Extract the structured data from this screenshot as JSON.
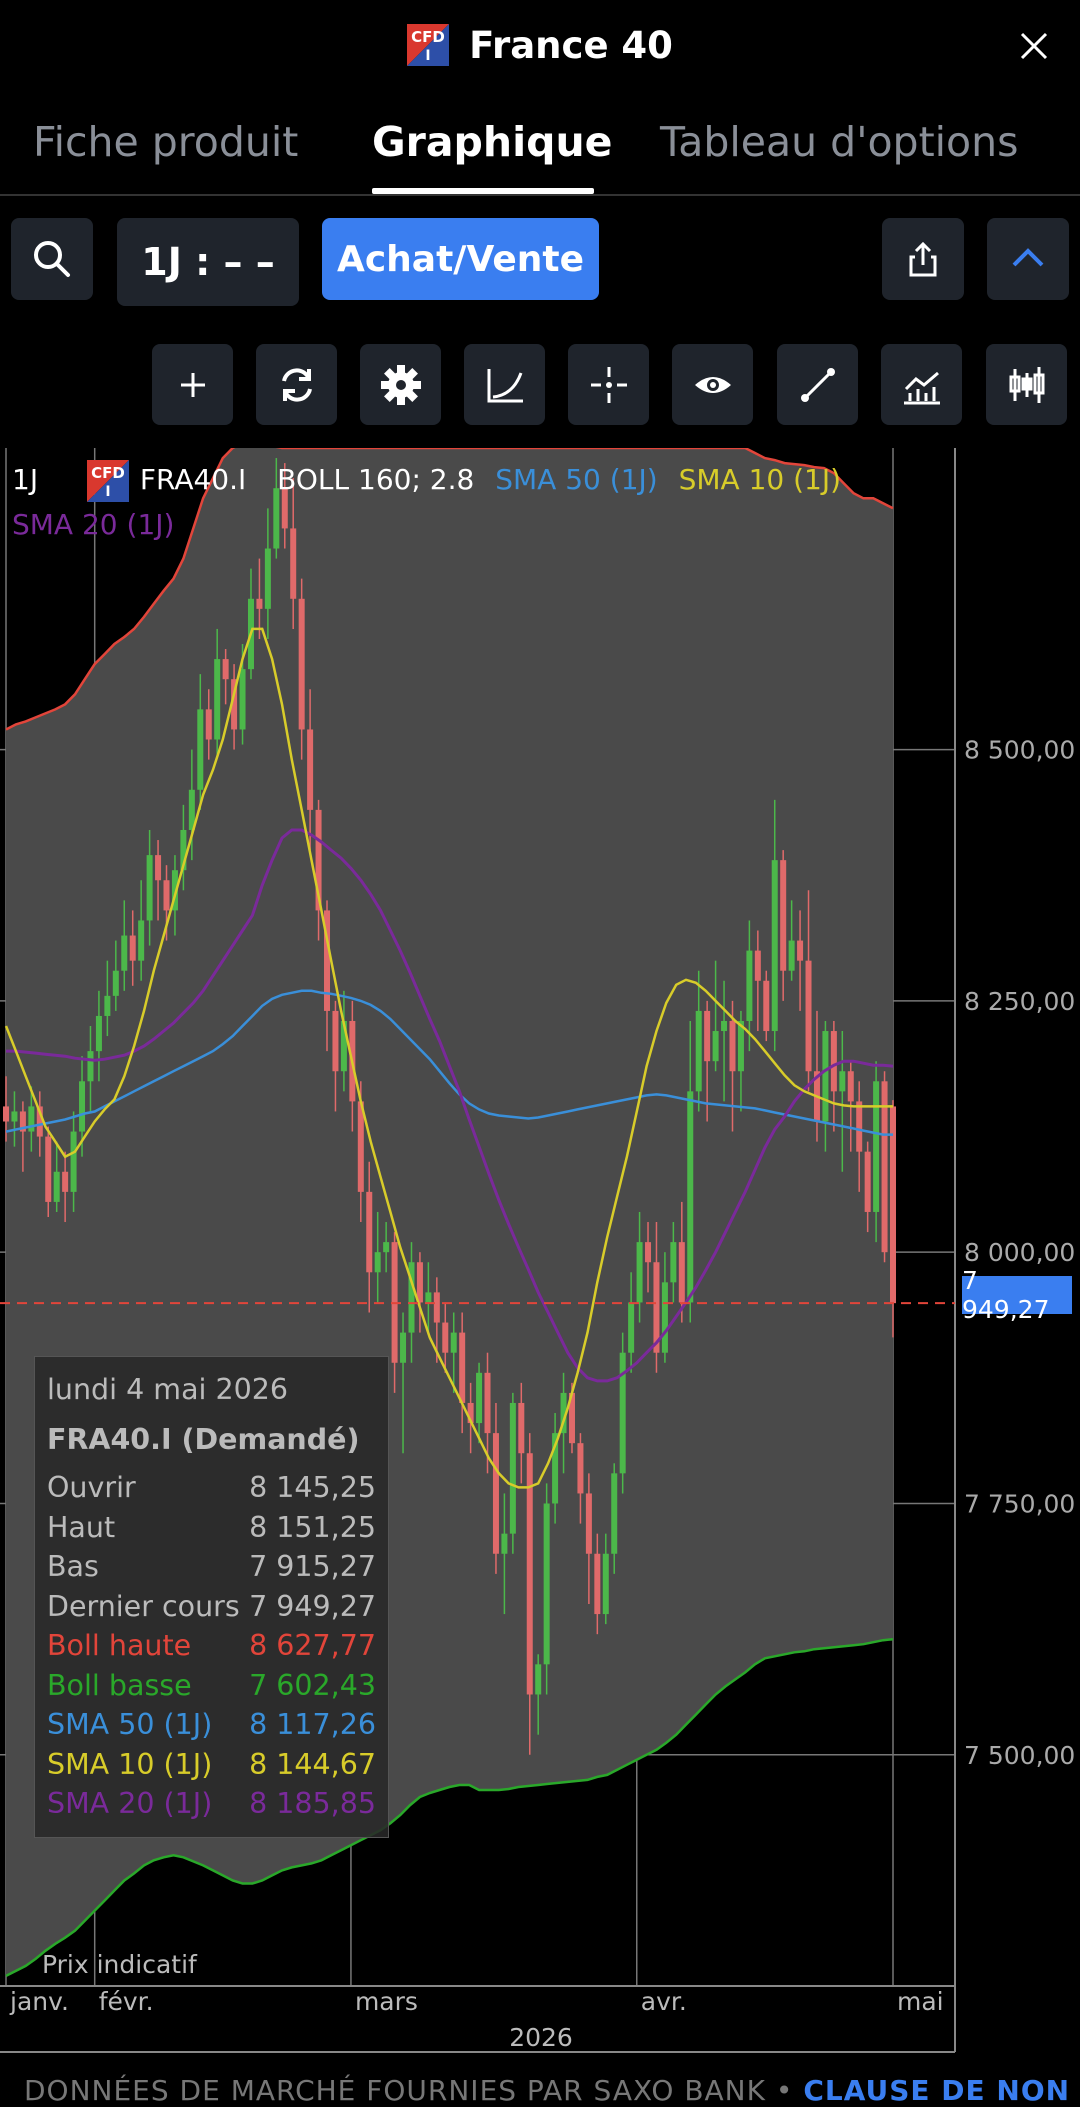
{
  "header": {
    "title": "France 40",
    "badge_top": "CFD",
    "badge_bottom": "I"
  },
  "tabs": [
    {
      "label": "Fiche produit",
      "active": false
    },
    {
      "label": "Graphique",
      "active": true
    },
    {
      "label": "Tableau d'options",
      "active": false
    }
  ],
  "toolbar": {
    "timeframe_label": "1J : – –",
    "trade_label": "Achat/Vente"
  },
  "tools": [
    "plus-icon",
    "refresh-icon",
    "gear-icon",
    "curve-icon",
    "crosshair-icon",
    "eye-icon",
    "line-tool-icon",
    "indicator-icon",
    "candlestick-icon"
  ],
  "legend": {
    "period": "1J",
    "symbol": "FRA40.I",
    "boll": "BOLL 160; 2.8",
    "sma50": "SMA 50 (1J)",
    "sma10": "SMA 10 (1J)",
    "sma20": "SMA 20 (1J)"
  },
  "colors": {
    "boll_upper": "#e2453a",
    "boll_lower": "#2aa82a",
    "sma50": "#3a8fd9",
    "sma10": "#d8cc2a",
    "sma20": "#7a2a9a",
    "bull": "#4cb84a",
    "bear": "#e06a6a",
    "accent": "#3a7ef0"
  },
  "tooltip": {
    "date": "lundi 4 mai 2026",
    "instrument": "FRA40.I (Demandé)",
    "rows": [
      {
        "label": "Ouvrir",
        "value": "8 145,25",
        "color": "#bbbbbb"
      },
      {
        "label": "Haut",
        "value": "8 151,25",
        "color": "#bbbbbb"
      },
      {
        "label": "Bas",
        "value": "7 915,27",
        "color": "#bbbbbb"
      },
      {
        "label": "Dernier cours",
        "value": "7 949,27",
        "color": "#bbbbbb"
      },
      {
        "label": "Boll haute",
        "value": "8 627,77",
        "color": "#e2453a"
      },
      {
        "label": "Boll basse",
        "value": "7 602,43",
        "color": "#2aa82a"
      },
      {
        "label": "SMA 50 (1J)",
        "value": "8 117,26",
        "color": "#3a8fd9"
      },
      {
        "label": "SMA 10 (1J)",
        "value": "8 144,67",
        "color": "#d8cc2a"
      },
      {
        "label": "SMA 20 (1J)",
        "value": "8 185,85",
        "color": "#7a2a9a"
      }
    ]
  },
  "price_tag": "7 949,27",
  "indicative": "Prix indicatif",
  "footer": {
    "text": "DONNÉES DE MARCHÉ FOURNIES PAR SAXO BANK • ",
    "link": "CLAUSE DE NON"
  },
  "chart_data": {
    "type": "candlestick",
    "y_ticks": [
      "8 500,00",
      "8 250,00",
      "8 000,00",
      "7 750,00",
      "7 500,00"
    ],
    "y_tick_values": [
      8500,
      8250,
      8000,
      7750,
      7500
    ],
    "ylim": [
      7270,
      8800
    ],
    "x_labels": [
      "janv.",
      "févr.",
      "mars",
      "avr.",
      "mai"
    ],
    "x_label_index": [
      0,
      9,
      35,
      64,
      90
    ],
    "year": "2026",
    "last_price": 7949.27,
    "boll_upper": [
      8520,
      8525,
      8528,
      8532,
      8536,
      8540,
      8545,
      8555,
      8570,
      8585,
      8595,
      8605,
      8612,
      8620,
      8632,
      8645,
      8658,
      8670,
      8690,
      8720,
      8750,
      8770,
      8790,
      8800,
      8805,
      8805,
      8803,
      8802,
      8800,
      8800,
      8800,
      8800,
      8800,
      8800,
      8800,
      8800,
      8800,
      8800,
      8800,
      8800,
      8800,
      8800,
      8800,
      8800,
      8800,
      8800,
      8800,
      8800,
      8800,
      8800,
      8800,
      8800,
      8800,
      8800,
      8800,
      8800,
      8800,
      8800,
      8800,
      8800,
      8800,
      8800,
      8800,
      8800,
      8800,
      8800,
      8800,
      8800,
      8800,
      8800,
      8800,
      8800,
      8800,
      8800,
      8800,
      8800,
      8795,
      8790,
      8788,
      8785,
      8784,
      8783,
      8781,
      8780,
      8775,
      8765,
      8755,
      8750,
      8750,
      8745,
      8740
    ],
    "boll_lower": [
      7280,
      7285,
      7290,
      7297,
      7305,
      7312,
      7318,
      7325,
      7335,
      7345,
      7355,
      7365,
      7375,
      7382,
      7390,
      7395,
      7398,
      7400,
      7398,
      7394,
      7390,
      7385,
      7380,
      7375,
      7372,
      7372,
      7375,
      7380,
      7385,
      7388,
      7390,
      7392,
      7395,
      7400,
      7405,
      7410,
      7415,
      7420,
      7425,
      7432,
      7440,
      7450,
      7458,
      7462,
      7465,
      7468,
      7470,
      7470,
      7465,
      7465,
      7465,
      7466,
      7468,
      7469,
      7470,
      7471,
      7472,
      7473,
      7474,
      7475,
      7478,
      7480,
      7485,
      7490,
      7495,
      7500,
      7505,
      7512,
      7520,
      7530,
      7540,
      7550,
      7560,
      7568,
      7575,
      7582,
      7590,
      7596,
      7598,
      7600,
      7602,
      7603,
      7605,
      7606,
      7607,
      7608,
      7609,
      7610,
      7612,
      7614,
      7615
    ],
    "sma50": [
      8120,
      8122,
      8124,
      8126,
      8128,
      8130,
      8132,
      8135,
      8138,
      8140,
      8145,
      8150,
      8155,
      8160,
      8165,
      8170,
      8175,
      8180,
      8185,
      8190,
      8195,
      8200,
      8207,
      8215,
      8225,
      8235,
      8245,
      8252,
      8256,
      8258,
      8260,
      8260,
      8258,
      8257,
      8255,
      8253,
      8250,
      8246,
      8240,
      8232,
      8222,
      8212,
      8202,
      8192,
      8180,
      8168,
      8157,
      8148,
      8142,
      8138,
      8136,
      8135,
      8134,
      8133,
      8134,
      8136,
      8138,
      8140,
      8142,
      8144,
      8146,
      8148,
      8150,
      8152,
      8154,
      8156,
      8157,
      8156,
      8154,
      8152,
      8150,
      8148,
      8147,
      8146,
      8145,
      8144,
      8143,
      8141,
      8139,
      8137,
      8135,
      8133,
      8131,
      8129,
      8127,
      8125,
      8123,
      8121,
      8119,
      8117,
      8117
    ],
    "sma10": [
      8225,
      8200,
      8175,
      8150,
      8125,
      8110,
      8095,
      8100,
      8115,
      8130,
      8142,
      8152,
      8175,
      8205,
      8240,
      8280,
      8315,
      8350,
      8385,
      8420,
      8455,
      8480,
      8510,
      8550,
      8590,
      8620,
      8620,
      8590,
      8545,
      8490,
      8440,
      8390,
      8340,
      8290,
      8240,
      8195,
      8150,
      8110,
      8075,
      8040,
      8005,
      7975,
      7945,
      7915,
      7895,
      7875,
      7855,
      7835,
      7815,
      7795,
      7780,
      7770,
      7766,
      7766,
      7770,
      7790,
      7815,
      7845,
      7880,
      7920,
      7970,
      8015,
      8055,
      8095,
      8140,
      8185,
      8220,
      8248,
      8266,
      8271,
      8268,
      8260,
      8250,
      8240,
      8230,
      8222,
      8212,
      8200,
      8188,
      8176,
      8166,
      8160,
      8156,
      8152,
      8148,
      8146,
      8145,
      8145,
      8145,
      8145,
      8145
    ],
    "sma20": [
      8200,
      8200,
      8199,
      8198,
      8197,
      8196,
      8195,
      8193,
      8192,
      8191,
      8192,
      8194,
      8196,
      8200,
      8205,
      8212,
      8220,
      8228,
      8238,
      8248,
      8260,
      8275,
      8290,
      8305,
      8320,
      8335,
      8365,
      8390,
      8412,
      8420,
      8420,
      8415,
      8408,
      8400,
      8392,
      8382,
      8370,
      8356,
      8340,
      8320,
      8300,
      8278,
      8255,
      8232,
      8210,
      8185,
      8160,
      8132,
      8105,
      8078,
      8052,
      8028,
      8005,
      7983,
      7960,
      7940,
      7920,
      7900,
      7885,
      7875,
      7872,
      7872,
      7875,
      7882,
      7890,
      7900,
      7910,
      7922,
      7936,
      7950,
      7965,
      7982,
      8000,
      8020,
      8040,
      8060,
      8082,
      8104,
      8122,
      8135,
      8150,
      8162,
      8172,
      8180,
      8186,
      8190,
      8190,
      8188,
      8186,
      8186,
      8185
    ],
    "candles": [
      [
        8145,
        8130,
        8175,
        8110
      ],
      [
        8130,
        8140,
        8160,
        8105
      ],
      [
        8140,
        8120,
        8150,
        8080
      ],
      [
        8120,
        8145,
        8165,
        8100
      ],
      [
        8145,
        8115,
        8160,
        8095
      ],
      [
        8115,
        8050,
        8125,
        8035
      ],
      [
        8050,
        8080,
        8110,
        8040
      ],
      [
        8080,
        8060,
        8100,
        8030
      ],
      [
        8060,
        8120,
        8140,
        8040
      ],
      [
        8120,
        8170,
        8195,
        8095
      ],
      [
        8170,
        8200,
        8225,
        8140
      ],
      [
        8200,
        8235,
        8260,
        8170
      ],
      [
        8235,
        8255,
        8290,
        8215
      ],
      [
        8255,
        8280,
        8310,
        8240
      ],
      [
        8280,
        8315,
        8350,
        8260
      ],
      [
        8315,
        8290,
        8340,
        8265
      ],
      [
        8290,
        8330,
        8370,
        8270
      ],
      [
        8330,
        8395,
        8420,
        8305
      ],
      [
        8395,
        8370,
        8410,
        8330
      ],
      [
        8370,
        8340,
        8385,
        8310
      ],
      [
        8340,
        8380,
        8395,
        8315
      ],
      [
        8380,
        8420,
        8445,
        8360
      ],
      [
        8420,
        8460,
        8500,
        8390
      ],
      [
        8460,
        8540,
        8575,
        8440
      ],
      [
        8540,
        8510,
        8560,
        8490
      ],
      [
        8510,
        8590,
        8620,
        8495
      ],
      [
        8590,
        8570,
        8600,
        8545
      ],
      [
        8570,
        8520,
        8585,
        8500
      ],
      [
        8520,
        8580,
        8605,
        8505
      ],
      [
        8580,
        8650,
        8680,
        8570
      ],
      [
        8650,
        8640,
        8690,
        8610
      ],
      [
        8640,
        8700,
        8740,
        8610
      ],
      [
        8700,
        8760,
        8790,
        8690
      ],
      [
        8760,
        8720,
        8785,
        8700
      ],
      [
        8720,
        8650,
        8770,
        8620
      ],
      [
        8650,
        8520,
        8670,
        8490
      ],
      [
        8520,
        8440,
        8560,
        8400
      ],
      [
        8440,
        8340,
        8450,
        8310
      ],
      [
        8340,
        8240,
        8350,
        8200
      ],
      [
        8240,
        8180,
        8250,
        8140
      ],
      [
        8180,
        8230,
        8260,
        8160
      ],
      [
        8230,
        8150,
        8250,
        8120
      ],
      [
        8150,
        8060,
        8170,
        8030
      ],
      [
        8060,
        7980,
        8090,
        7940
      ],
      [
        7980,
        8000,
        8040,
        7950
      ],
      [
        8000,
        8010,
        8030,
        7980
      ],
      [
        8010,
        7890,
        8020,
        7860
      ],
      [
        7890,
        7920,
        7940,
        7800
      ],
      [
        7920,
        7990,
        8010,
        7890
      ],
      [
        7990,
        7950,
        8000,
        7920
      ],
      [
        7950,
        7960,
        7990,
        7920
      ],
      [
        7960,
        7930,
        7975,
        7890
      ],
      [
        7930,
        7900,
        7950,
        7880
      ],
      [
        7900,
        7920,
        7940,
        7860
      ],
      [
        7920,
        7850,
        7940,
        7820
      ],
      [
        7850,
        7830,
        7870,
        7800
      ],
      [
        7830,
        7880,
        7890,
        7810
      ],
      [
        7880,
        7820,
        7900,
        7780
      ],
      [
        7820,
        7700,
        7850,
        7680
      ],
      [
        7700,
        7720,
        7760,
        7640
      ],
      [
        7720,
        7850,
        7860,
        7700
      ],
      [
        7850,
        7800,
        7870,
        7770
      ],
      [
        7800,
        7560,
        7820,
        7500
      ],
      [
        7560,
        7590,
        7600,
        7520
      ],
      [
        7590,
        7750,
        7770,
        7560
      ],
      [
        7750,
        7820,
        7840,
        7730
      ],
      [
        7820,
        7860,
        7880,
        7780
      ],
      [
        7860,
        7810,
        7870,
        7800
      ],
      [
        7810,
        7760,
        7820,
        7730
      ],
      [
        7760,
        7700,
        7780,
        7650
      ],
      [
        7700,
        7640,
        7720,
        7620
      ],
      [
        7640,
        7700,
        7720,
        7630
      ],
      [
        7700,
        7780,
        7790,
        7680
      ],
      [
        7780,
        7900,
        7920,
        7760
      ],
      [
        7900,
        7950,
        7980,
        7880
      ],
      [
        7950,
        8010,
        8040,
        7930
      ],
      [
        8010,
        7990,
        8030,
        7960
      ],
      [
        7990,
        7900,
        8030,
        7880
      ],
      [
        7900,
        7970,
        8000,
        7890
      ],
      [
        7970,
        8010,
        8030,
        7950
      ],
      [
        8010,
        7950,
        8050,
        7930
      ],
      [
        7950,
        8160,
        8230,
        7930
      ],
      [
        8160,
        8240,
        8280,
        8140
      ],
      [
        8240,
        8190,
        8250,
        8130
      ],
      [
        8190,
        8220,
        8290,
        8180
      ],
      [
        8220,
        8230,
        8270,
        8150
      ],
      [
        8230,
        8180,
        8250,
        8120
      ],
      [
        8180,
        8230,
        8240,
        8140
      ],
      [
        8230,
        8300,
        8330,
        8200
      ],
      [
        8300,
        8270,
        8320,
        8220
      ],
      [
        8270,
        8220,
        8280,
        8210
      ],
      [
        8220,
        8390,
        8450,
        8200
      ],
      [
        8390,
        8280,
        8400,
        8250
      ],
      [
        8280,
        8310,
        8350,
        8270
      ],
      [
        8310,
        8290,
        8340,
        8240
      ],
      [
        8290,
        8180,
        8360,
        8160
      ],
      [
        8180,
        8130,
        8240,
        8110
      ],
      [
        8130,
        8220,
        8230,
        8100
      ],
      [
        8220,
        8160,
        8230,
        8120
      ],
      [
        8160,
        8180,
        8220,
        8080
      ],
      [
        8180,
        8150,
        8190,
        8100
      ],
      [
        8150,
        8100,
        8170,
        8060
      ],
      [
        8100,
        8040,
        8110,
        8020
      ],
      [
        8040,
        8170,
        8190,
        8010
      ],
      [
        8170,
        8000,
        8180,
        7990
      ],
      [
        8145,
        7949.27,
        8151.25,
        7915.27
      ]
    ]
  }
}
